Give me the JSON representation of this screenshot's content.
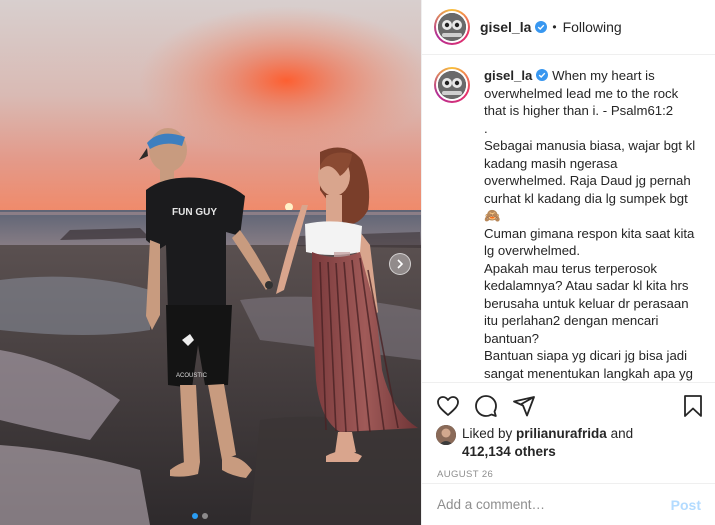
{
  "post": {
    "username": "gisel_la",
    "separator": "•",
    "follow_status": "Following",
    "photo_alt": "Couple holding hands on rocky beach at sunset"
  },
  "caption": {
    "username": "gisel_la",
    "text": "When my heart is overwhelmed lead me to the rock that is higher than i. - Psalm61:2\n.\nSebagai manusia biasa, wajar bgt kl kadang masih ngerasa overwhelmed. Raja Daud jg pernah curhat kl kadang dia lg sumpek bgt\n🙈\nCuman gimana respon kita saat kita lg overwhelmed.\nApakah mau terus terperosok kedalamnya? Atau sadar kl kita hrs berusaha untuk keluar dr perasaan itu perlahan2 dengan mencari bantuan?\nBantuan siapa yg dicari jg bisa jadi sangat menentukan langkah apa yg kita ambil setelah itu"
  },
  "likes": {
    "prefix": "Liked by ",
    "liker": "prilianurafrida",
    "and": " and",
    "count": "412,134 others"
  },
  "date": "AUGUST 26",
  "comment": {
    "placeholder": "Add a comment…",
    "post_label": "Post"
  },
  "carousel": {
    "total": 2,
    "active": 1
  },
  "colors": {
    "link_blue": "#0095f6",
    "verified_blue": "#3897f0",
    "post_disabled": "#b3dbff",
    "meta_gray": "#8e8e8e"
  },
  "icons": [
    "heart-icon",
    "comment-icon",
    "share-icon",
    "bookmark-icon",
    "verified-badge-icon",
    "carousel-next-icon"
  ]
}
